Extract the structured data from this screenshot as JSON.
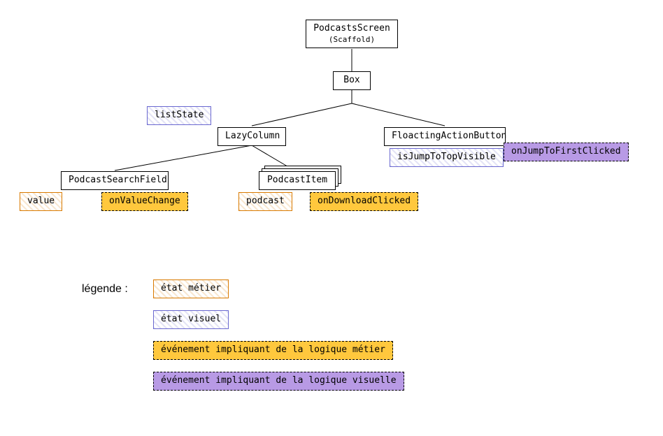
{
  "nodes": {
    "root_title": "PodcastsScreen",
    "root_sub": "(Scaffold)",
    "box": "Box",
    "lazycolumn": "LazyColumn",
    "fab": "FloactingActionButton",
    "searchfield": "PodcastSearchField",
    "podcastitem": "PodcastItem"
  },
  "tags": {
    "listState": "listState",
    "value": "value",
    "onValueChange": "onValueChange",
    "podcast": "podcast",
    "onDownloadClicked": "onDownloadClicked",
    "isJumpToTopVisible": "isJumpToTopVisible",
    "onJumpToFirstClicked": "onJumpToFirstClicked"
  },
  "legend": {
    "label": "légende :",
    "etat_metier": "état métier",
    "etat_visuel": "état visuel",
    "ev_metier": "événement impliquant de la logique métier",
    "ev_visuel": "événement impliquant de la logique visuelle"
  }
}
